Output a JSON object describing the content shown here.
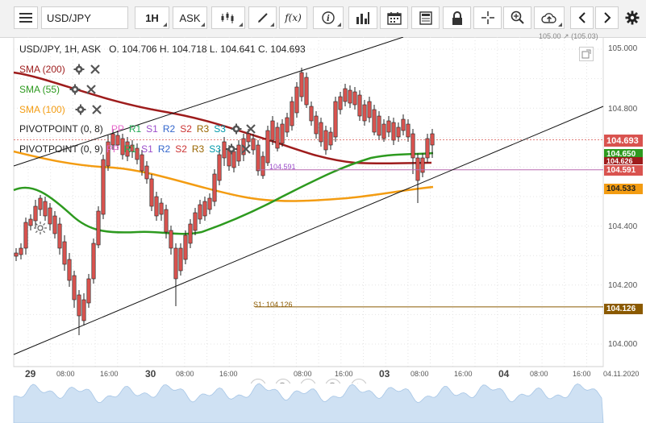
{
  "toolbar": {
    "symbol": "USD/JPY",
    "timeframe": "1H",
    "price_type": "ASK",
    "function_label": "f(x)"
  },
  "info": {
    "symbol_line": "USD/JPY, 1H, ASK",
    "ohlc": "O. 104.706 H. 104.718 L. 104.641 C. 104.693"
  },
  "indicators": {
    "sma200": "SMA (200)",
    "sma55": "SMA (55)",
    "sma100": "SMA (100)",
    "pivot1": "PIVOTPOINT (0, 8)",
    "pivot2": "PIVOTPOINT (0, 9)",
    "pivot_items": [
      "PP",
      "R1",
      "S1",
      "R2",
      "S2",
      "R3",
      "S3"
    ]
  },
  "colors": {
    "sma200": "#9e1c1c",
    "sma55": "#2d9a1f",
    "sma100": "#f39c12",
    "pp": "#e66acb",
    "r1": "#22aa55",
    "s1": "#9b4dca",
    "r2": "#3366cc",
    "s2": "#cc3333",
    "r3": "#996600",
    "s3": "#0099aa",
    "price": "#d9534f",
    "candle_up": "#5cb85c",
    "candle_down": "#d9534f",
    "s1_line": "#8b5a00"
  },
  "price_axis": {
    "labels": [
      "105.000",
      "104.800",
      "104.400",
      "104.200",
      "104.000"
    ],
    "partial_top": "105.00 ↗ (105.03)"
  },
  "tags": {
    "current": "104.693",
    "sma55": "104.650",
    "sma200": "104.626",
    "pivot": "104.591",
    "sma100": "104.533",
    "s1": "104.126"
  },
  "annotations": {
    "pivot_label": "104.591",
    "s1_label": "S1: 104.126"
  },
  "time_axis": {
    "labels": [
      "29",
      "08:00",
      "16:00",
      "30",
      "08:00",
      "16:00",
      "08:00",
      "16:00",
      "03",
      "08:00",
      "16:00",
      "04",
      "08:00",
      "16:00",
      "04.11.2020"
    ]
  },
  "chart_data": {
    "type": "candlestick",
    "y_axis_ticks": [
      104.0,
      104.2,
      104.4,
      104.8,
      105.0
    ],
    "ylim": [
      103.95,
      105.05
    ],
    "current_price": 104.693,
    "sma_55": 104.65,
    "sma_200": 104.626,
    "sma_100": 104.533,
    "pivot": 104.591,
    "s1": 104.126
  }
}
